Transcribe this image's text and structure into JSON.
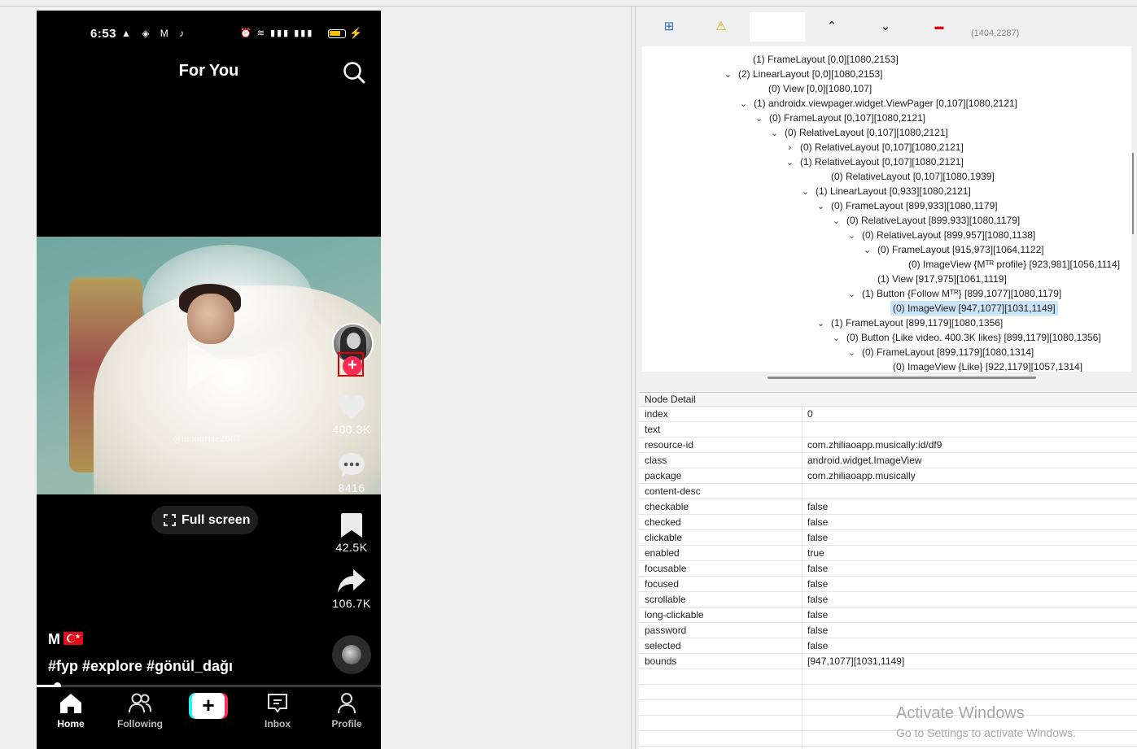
{
  "phone": {
    "status": {
      "time": "6:53",
      "left_icons": "▲ ◈ M ♪",
      "right_icons": "⏰ ≋ ▮▮▮ ▮▮▮",
      "charging": "⚡"
    },
    "title": "For You",
    "video": {
      "watermark": "@moonrise2007"
    },
    "actions": {
      "likes": "400.3K",
      "comments": "8416",
      "saves": "42.5K",
      "shares": "106.7K"
    },
    "fullscreen_label": "Full screen",
    "username": "M",
    "caption": "#fyp #explore #gönül_dağı",
    "progress_fraction": 0.06,
    "nav": {
      "home": "Home",
      "following": "Following",
      "create": "+",
      "inbox": "Inbox",
      "profile": "Profile"
    }
  },
  "inspector": {
    "toolbar": {
      "expand_icon": "⊞",
      "warning_icon": "⚠",
      "up_icon": "⌃",
      "down_icon": "⌄",
      "minus_icon": "▬",
      "coords": "(1404,2287)"
    },
    "tree": [
      {
        "caret": "",
        "label": "(1) FrameLayout [0,0][1080,2153]"
      },
      {
        "caret": "⌄",
        "label": "(2) LinearLayout [0,0][1080,2153]"
      },
      {
        "caret": "",
        "label": "(0) View [0,0][1080,107]"
      },
      {
        "caret": "⌄",
        "label": "(1) androidx.viewpager.widget.ViewPager [0,107][1080,2121]"
      },
      {
        "caret": "⌄",
        "label": "(0) FrameLayout [0,107][1080,2121]"
      },
      {
        "caret": "⌄",
        "label": "(0) RelativeLayout [0,107][1080,2121]"
      },
      {
        "caret": "›",
        "label": "(0) RelativeLayout [0,107][1080,2121]"
      },
      {
        "caret": "⌄",
        "label": "(1) RelativeLayout [0,107][1080,2121]"
      },
      {
        "caret": "",
        "label": "(0) RelativeLayout [0,107][1080,1939]"
      },
      {
        "caret": "⌄",
        "label": "(1) LinearLayout [0,933][1080,2121]"
      },
      {
        "caret": "⌄",
        "label": "(0) FrameLayout [899,933][1080,1179]"
      },
      {
        "caret": "⌄",
        "label": "(0) RelativeLayout [899,933][1080,1179]"
      },
      {
        "caret": "⌄",
        "label": "(0) RelativeLayout [899,957][1080,1138]"
      },
      {
        "caret": "⌄",
        "label": "(0) FrameLayout [915,973][1064,1122]"
      },
      {
        "caret": "",
        "label": "(0) ImageView {Mᵀᴿ profile} [923,981][1056,1114]"
      },
      {
        "caret": "",
        "label": "(1) View [917,975][1061,1119]"
      },
      {
        "caret": "⌄",
        "label": "(1) Button {Follow Mᵀᴿ} [899,1077][1080,1179]"
      },
      {
        "caret": "",
        "label": "(0) ImageView [947,1077][1031,1149]"
      },
      {
        "caret": "⌄",
        "label": "(1) FrameLayout [899,1179][1080,1356]"
      },
      {
        "caret": "⌄",
        "label": "(0) Button {Like video. 400.3K likes} [899,1179][1080,1356]"
      },
      {
        "caret": "⌄",
        "label": "(0) FrameLayout [899,1179][1080,1314]"
      },
      {
        "caret": "",
        "label": "(0) ImageView {Like} [922,1179][1057,1314]"
      }
    ],
    "selected_index": 17,
    "detail_header": "Node Detail",
    "details": [
      {
        "key": "index",
        "value": "0"
      },
      {
        "key": "text",
        "value": ""
      },
      {
        "key": "resource-id",
        "value": "com.zhiliaoapp.musically:id/df9"
      },
      {
        "key": "class",
        "value": "android.widget.ImageView"
      },
      {
        "key": "package",
        "value": "com.zhiliaoapp.musically"
      },
      {
        "key": "content-desc",
        "value": ""
      },
      {
        "key": "checkable",
        "value": "false"
      },
      {
        "key": "checked",
        "value": "false"
      },
      {
        "key": "clickable",
        "value": "false"
      },
      {
        "key": "enabled",
        "value": "true"
      },
      {
        "key": "focusable",
        "value": "false"
      },
      {
        "key": "focused",
        "value": "false"
      },
      {
        "key": "scrollable",
        "value": "false"
      },
      {
        "key": "long-clickable",
        "value": "false"
      },
      {
        "key": "password",
        "value": "false"
      },
      {
        "key": "selected",
        "value": "false"
      },
      {
        "key": "bounds",
        "value": "[947,1077][1031,1149]"
      }
    ]
  },
  "watermark": {
    "title": "Activate Windows",
    "subtitle": "Go to Settings to activate Windows."
  }
}
